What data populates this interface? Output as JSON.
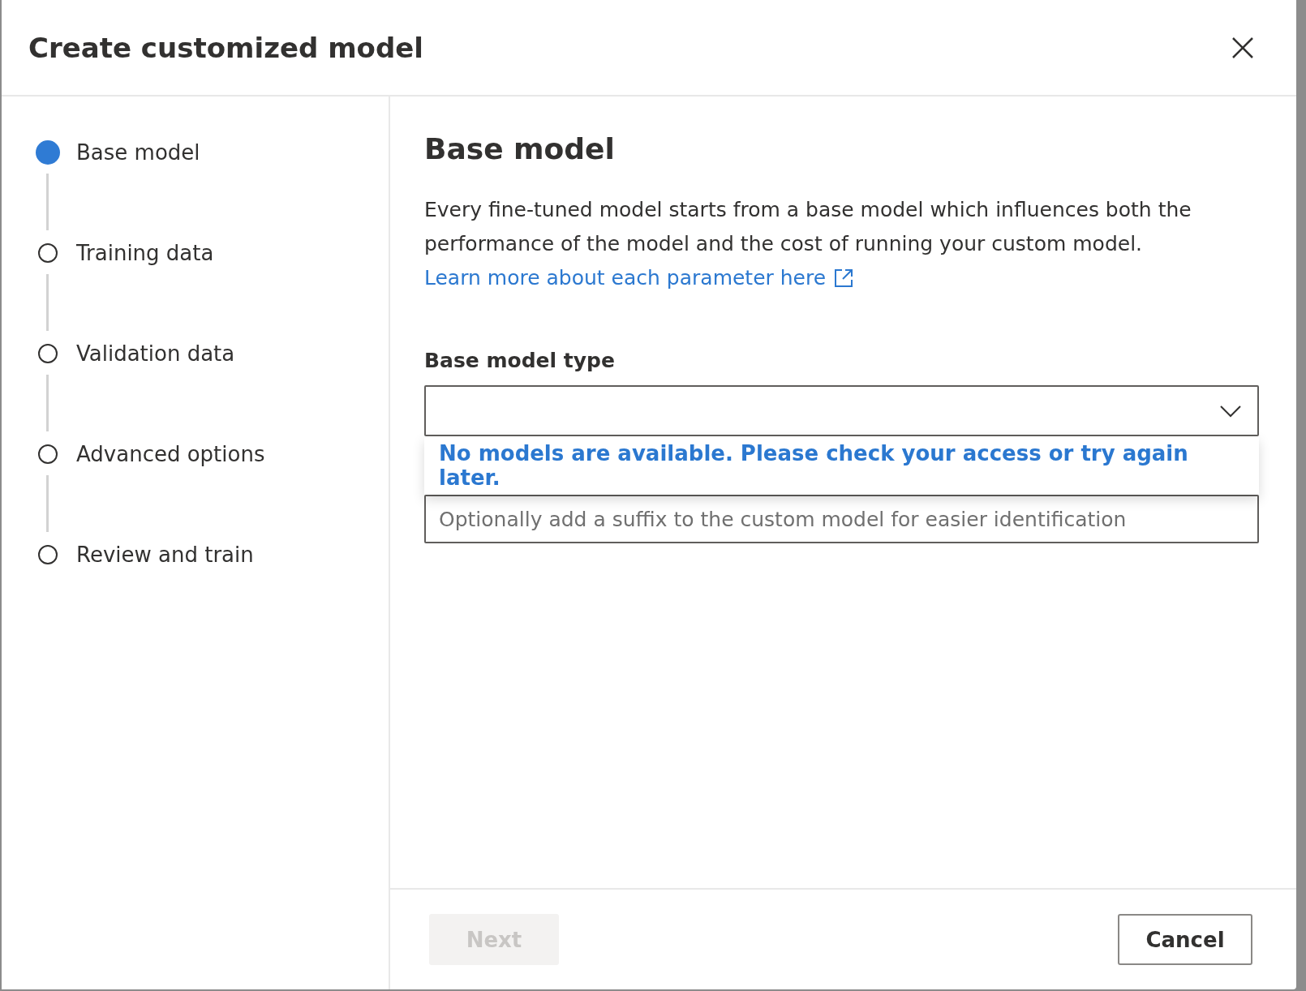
{
  "dialog": {
    "title": "Create customized model"
  },
  "steps": [
    {
      "label": "Base model",
      "selected": true
    },
    {
      "label": "Training data",
      "selected": false
    },
    {
      "label": "Validation data",
      "selected": false
    },
    {
      "label": "Advanced options",
      "selected": false
    },
    {
      "label": "Review and train",
      "selected": false
    }
  ],
  "section": {
    "heading": "Base model",
    "description": "Every fine-tuned model starts from a base model which influences both the performance of the model and the cost of running your custom model.",
    "link": "Learn more about each parameter here"
  },
  "base_model_type": {
    "label": "Base model type",
    "expanded": true,
    "message": "No models are available. Please check your access or try again later."
  },
  "suffix_field": {
    "placeholder": "Optionally add a suffix to the custom model for easier identification"
  },
  "buttons": [
    {
      "label": "Next",
      "disabled": true
    },
    {
      "label": "Cancel",
      "disabled": false
    }
  ]
}
